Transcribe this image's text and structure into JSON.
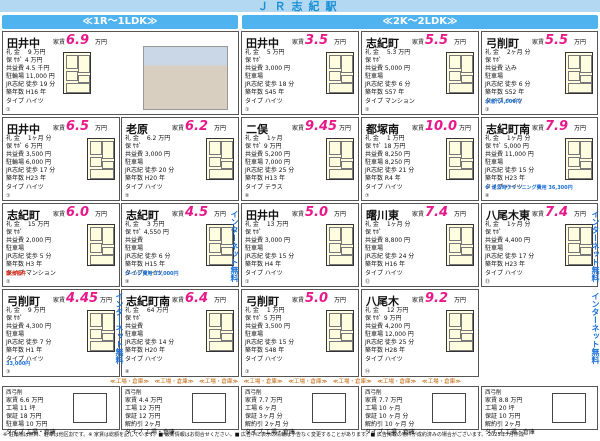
{
  "header": {
    "title": "ＪＲ志紀駅",
    "left": "≪1R～1LDK≫",
    "right": "≪2K～2LDK≫"
  },
  "yachin": "家賃",
  "man": "万円",
  "cells": [
    {
      "name": "田井中",
      "price": "6.9",
      "rows": [
        "礼 金　 9 万円",
        "保 ｻﾎﾟ 4 万円",
        "共益費 4.5 千円",
        "駐輪場 11,000 円",
        "JR志紀 徒歩 19 分",
        "築年数 H16 年",
        "タイプ ハイツ"
      ],
      "num": "①"
    },
    {
      "name": "田井中",
      "price": "3.5",
      "rows": [
        "礼 金　 5 万円",
        "保 ｻﾎﾟ",
        "共益費 3,000 円",
        "駐車場",
        "JR志紀 徒歩 18 分",
        "築年数 S45 年",
        "タイプ ハイツ"
      ],
      "num": "①"
    },
    {
      "name": "志紀町",
      "price": "5.5",
      "rows": [
        "礼 金　 5.3 万円",
        "保 ｻﾎﾟ",
        "共益費 5,000 円",
        "駐車場",
        "JR志紀 徒歩 6 分",
        "築年数 S57 年",
        "タイプ マンション"
      ],
      "num": "②"
    },
    {
      "name": "弓削町",
      "price": "5.5",
      "rows": [
        "礼 金　 2ヶ月 分",
        "保 ｻﾎﾟ",
        "共益費 込み",
        "駐車場",
        "JR志紀 徒歩 6 分",
        "築年数 S52 年",
        "タイプ ハイツ"
      ],
      "num": "③",
      "extra": "水道代4,000円"
    },
    {
      "name": "田井中",
      "price": "6.5",
      "rows": [
        "礼 金　 1ヶ月 分",
        "保 ｻﾎﾟ 6 万円",
        "共益費 3,500 円",
        "駐輪場 6,000 円",
        "JR志紀 徒歩 17 分",
        "築年数 H23 年",
        "タイプ ハイツ"
      ],
      "num": "①"
    },
    {
      "name": "老原",
      "price": "6.2",
      "rows": [
        "礼 金　 6.2 万円",
        "保 ｻﾎﾟ",
        "共益費 3,000 円",
        "駐車場",
        "JR志紀 徒歩 20 分",
        "築年数 H20 年",
        "タイプ ハイツ"
      ],
      "num": "⑤"
    },
    {
      "name": "二俣",
      "price": "9.45",
      "rows": [
        "礼 金　 1ヶ月",
        "保 ｻﾎﾟ 9 万円",
        "共益費 5,200 円",
        "駐車場 7,000 円",
        "JR志紀 徒歩 25 分",
        "築年数 H13 年",
        "タイプ テラス"
      ],
      "num": "⑥"
    },
    {
      "name": "都塚南",
      "price": "10.0",
      "rows": [
        "礼 金　 1 万円",
        "保 ｻﾎﾟ 18 万円",
        "共益費 8,250 円",
        "駐車場 8,250 円",
        "JR志紀 徒歩 21 分",
        "築年数 R4 年",
        "タイプ ハイツ"
      ],
      "num": "⑦"
    },
    {
      "name": "志紀町南",
      "price": "7.9",
      "rows": [
        "礼 金　 1ヶ月 分",
        "保 ｻﾎﾟ 5,000 円",
        "共益費 11,000 円",
        "駐車場",
        "JR志紀 徒歩 15 分",
        "築年数 H23 年",
        "タイプ ハイツ"
      ],
      "num": "⑧",
      "extra": "※ 退去時クリーニング費用 36,300円"
    },
    {
      "name": "志紀町",
      "price": "6.0",
      "rows": [
        "礼 金　 15 万円",
        "保 ｻﾎﾟ",
        "共益費 2,000 円",
        "駐車場",
        "JR志紀 徒歩 5 分",
        "築年数 H3 年",
        "タイプ マンション"
      ],
      "num": "②",
      "extra": "築浅物件"
    },
    {
      "name": "志紀町",
      "price": "4.5",
      "rows": [
        "礼 金　 3 万円",
        "保 ｻﾎﾟ 4,550 円",
        "共益費",
        "駐車場",
        "JR志紀 徒歩 6 分",
        "築年数 H15 年",
        "タイプ ハイツ"
      ],
      "num": "⑨",
      "extra": "ｸﾘｰﾆﾝｸﾞ費用 33,000円"
    },
    {
      "name": "田井中",
      "price": "5.0",
      "rows": [
        "礼 金　 13 万円",
        "保 ｻﾎﾟ",
        "共益費 3,000 円",
        "駐車場",
        "JR志紀 徒歩 15 分",
        "築年数 H4 年",
        "タイプ ハイツ"
      ],
      "num": "①"
    },
    {
      "name": "曙川東",
      "price": "7.4",
      "rows": [
        "礼 金　 1ヶ月 分",
        "保 ｻﾎﾟ",
        "共益費 8,800 円",
        "駐車場",
        "JR志紀 徒歩 24 分",
        "築年数 H16 年",
        "タイプ ハイツ"
      ],
      "num": "⑫"
    },
    {
      "name": "八尾木東",
      "price": "7.4",
      "rows": [
        "礼 金　 1ヶ月 分",
        "保 ｻﾎﾟ",
        "共益費 4,400 円",
        "駐車場",
        "JR志紀 徒歩 17 分",
        "築年数 H23 年",
        "タイプ ハイツ"
      ],
      "num": "⑬"
    },
    {
      "name": "弓削町",
      "price": "4.45",
      "rows": [
        "礼 金　 9 万円",
        "保 ｻﾎﾟ",
        "共益費 4,300 円",
        "駐車場",
        "JR志紀 徒歩 7 分",
        "築年数 H1 年",
        "タイプ ハイツ"
      ],
      "num": "③",
      "extra": "33,000円"
    },
    {
      "name": "志紀町南",
      "price": "6.4",
      "rows": [
        "礼 金　 64 万円",
        "保 ｻﾎﾟ",
        "共益費",
        "駐車場",
        "JR志紀 徒歩 14 分",
        "築年数 H20 年",
        "タイプ ハイツ"
      ],
      "num": "⑧"
    },
    {
      "name": "弓削町",
      "price": "5.0",
      "rows": [
        "礼 金　 1 万円",
        "保 ｻﾎﾟ 5 万円",
        "共益費 3,500 円",
        "駐車場",
        "JR志紀 徒歩 15 分",
        "築年数 S48 年",
        "タイプ ハイツ"
      ],
      "num": "③"
    },
    {
      "name": "八尾木",
      "price": "9.2",
      "rows": [
        "礼 金　 12 万円",
        "保 ｻﾎﾟ 9 万円",
        "共益費 4,200 円",
        "駐車場 12,000 円",
        "JR志紀 徒歩 25 分",
        "築年数 H28 年",
        "タイプ ハイツ"
      ],
      "num": "⑭"
    }
  ],
  "internet": "インターネット無料",
  "banner": "≪工場・倉庫≫",
  "bottom": [
    {
      "title": "西弓削",
      "rows": [
        "家賃 6.6 万円",
        "工場 11 坪",
        "保証 18 万円",
        "駐車場 10 万円",
        "タイプ 工場・倉庫"
      ]
    },
    {
      "title": "西弓削",
      "rows": [
        "家賃 4.4 万円",
        "工場 12 万円",
        "保証 12 万円",
        "解約引 2ヶ月",
        "タイプ 工場・倉庫"
      ]
    },
    {
      "title": "西弓削",
      "rows": [
        "家賃 7.7 万円",
        "工場 6 ヶ月",
        "保証 3ヶ月 分",
        "解約引 2ヶ月 分",
        "タイプ 工場・倉庫"
      ]
    },
    {
      "title": "西弓削",
      "rows": [
        "家賃 7.7 万円",
        "工場 10 ヶ月",
        "保証 10 ヶ月 分",
        "解約引 10 ヶ月 分",
        "タイプ 工場・倉庫"
      ]
    },
    {
      "title": "西弓削",
      "rows": [
        "家賃 8.8 万円",
        "工場 20 坪",
        "保証 10 万円",
        "解約引 2ヶ月",
        "タイプ 工場・倉庫"
      ]
    }
  ],
  "footer": "※ 駐輪場は無料、駐車は他区割です。※ 家賃は総額を記しています。■ 最新情報はお問合せください。■ 広告中に表示の情報は予告なく変更することがあります。■ 広告掲載の物件が成約済みの場合がございます。 2025年7月作成"
}
